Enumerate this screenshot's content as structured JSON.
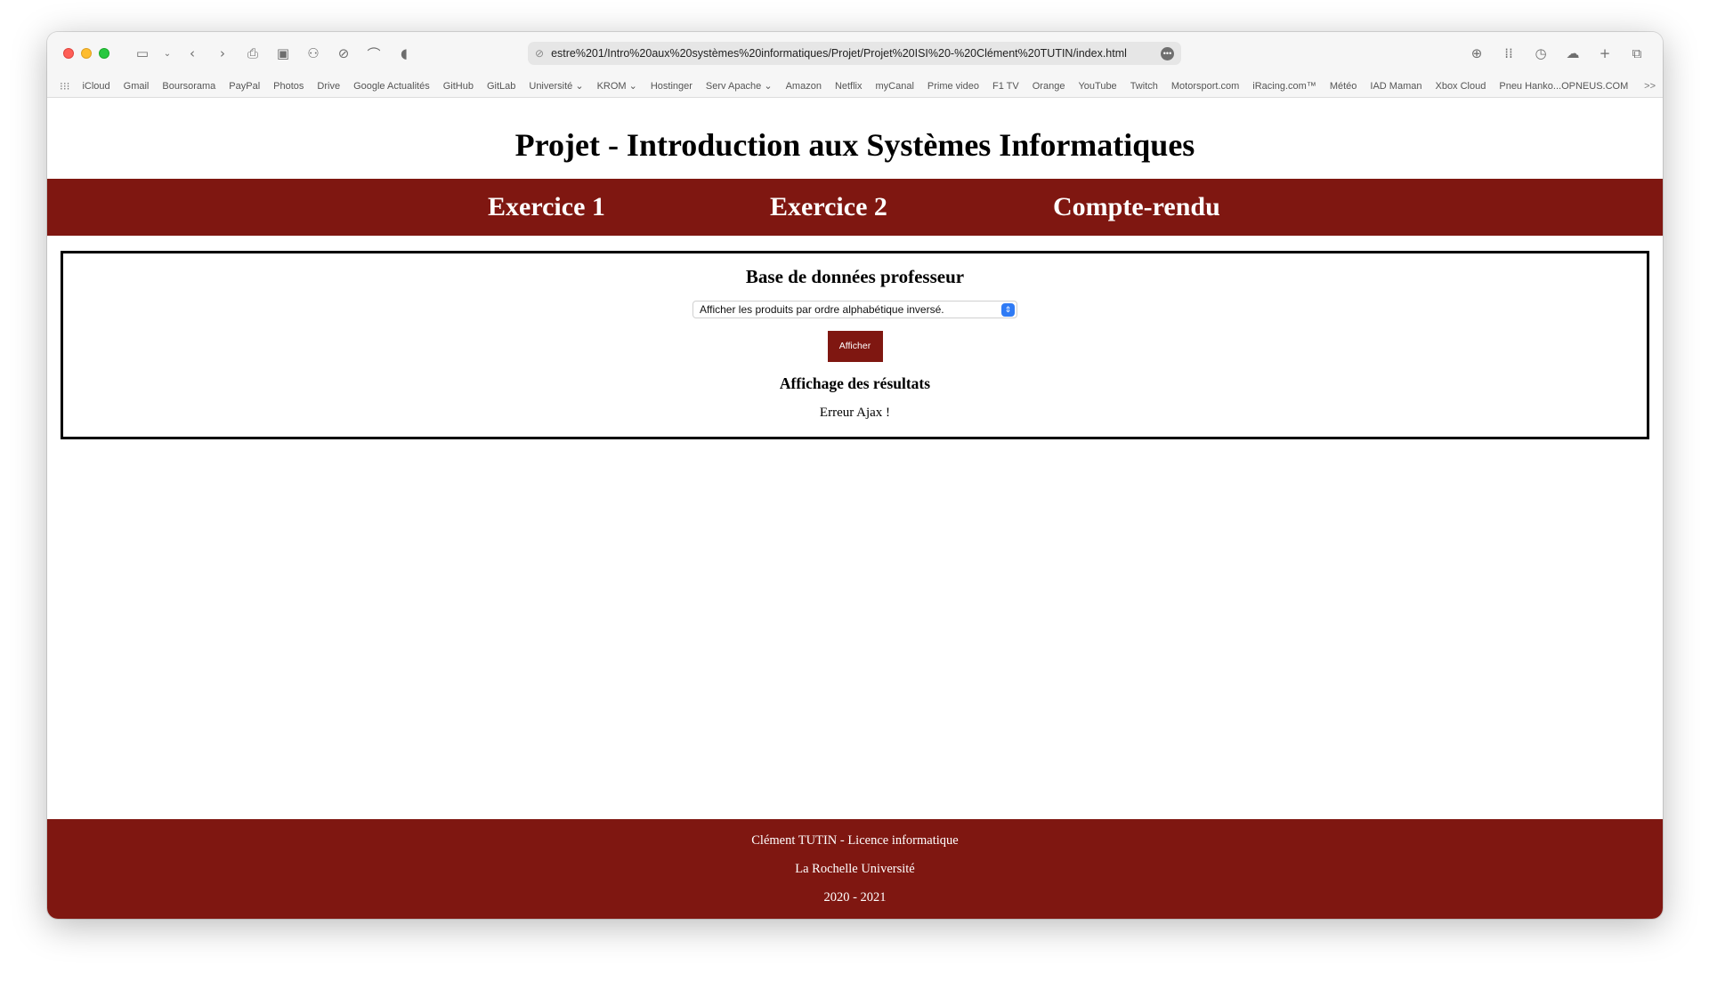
{
  "browser": {
    "url": "estre%201/Intro%20aux%20systèmes%20informatiques/Projet/Projet%20ISI%20-%20Clément%20TUTIN/index.html",
    "bookmarks": [
      "iCloud",
      "Gmail",
      "Boursorama",
      "PayPal",
      "Photos",
      "Drive",
      "Google Actualités",
      "GitHub",
      "GitLab",
      "Université ⌄",
      "KROM ⌄",
      "Hostinger",
      "Serv Apache ⌄",
      "Amazon",
      "Netflix",
      "myCanal",
      "Prime video",
      "F1 TV",
      "Orange",
      "YouTube",
      "Twitch",
      "Motorsport.com",
      "iRacing.com™",
      "Météo",
      "IAD Maman",
      "Xbox Cloud",
      "Pneu Hanko...OPNEUS.COM"
    ],
    "bookmarks_more": ">>"
  },
  "page": {
    "title": "Projet - Introduction aux Systèmes Informatiques",
    "nav": [
      "Exercice 1",
      "Exercice 2",
      "Compte-rendu"
    ],
    "section_title": "Base de données professeur",
    "select_value": "Afficher les produits par ordre alphabétique inversé.",
    "button_label": "Afficher",
    "results_title": "Affichage des résultats",
    "results_text": "Erreur Ajax !",
    "footer": [
      "Clément TUTIN - Licence informatique",
      "La Rochelle Université",
      "2020 - 2021"
    ]
  },
  "colors": {
    "accent": "#7f1711"
  }
}
